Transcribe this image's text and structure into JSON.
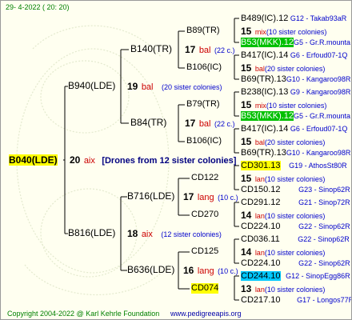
{
  "date": "29- 4-2022 ( 20: 20)",
  "root": {
    "id": "B040(LDE)",
    "num": "20",
    "breed": "aix",
    "drones": "[Drones from 12 sister colonies]"
  },
  "gen1": [
    {
      "id": "B940(LDE)",
      "num": "19",
      "breed": "bal",
      "colonies": "(20 sister colonies)"
    },
    {
      "id": "B816(LDE)",
      "num": "18",
      "breed": "aix",
      "colonies": "(12 sister colonies)"
    }
  ],
  "gen2": [
    {
      "id": "B140(TR)",
      "num": "17",
      "breed": "bal",
      "colonies": "(22 c.)"
    },
    {
      "id": "B84(TR)",
      "num": "17",
      "breed": "bal",
      "colonies": "(22 c.)"
    },
    {
      "id": "B716(LDE)",
      "num": "17",
      "breed": "lang",
      "colonies": "(10 c.)"
    },
    {
      "id": "B636(LDE)",
      "num": "16",
      "breed": "lang",
      "colonies": "(10 c.)"
    }
  ],
  "gen3": [
    {
      "id": "B89(TR)",
      "num": "15",
      "breed": "mix",
      "colonies": "(10 sister colonies)"
    },
    {
      "id": "B106(IC)",
      "num": "15",
      "breed": "bal",
      "colonies": "(20 sister colonies)"
    },
    {
      "id": "B79(TR)",
      "num": "15",
      "breed": "mix",
      "colonies": "(10 sister colonies)"
    },
    {
      "id": "B106(IC)",
      "num": "15",
      "breed": "bal",
      "colonies": "(20 sister colonies)"
    },
    {
      "id": "CD122",
      "num": "15",
      "breed": "lan",
      "colonies": "(10 sister colonies)"
    },
    {
      "id": "CD270",
      "num": "14",
      "breed": "lan",
      "colonies": "(10 sister colonies)"
    },
    {
      "id": "CD125",
      "num": "14",
      "breed": "lan",
      "colonies": "(10 sister colonies)"
    },
    {
      "id": "CD074",
      "num": "13",
      "breed": "lan",
      "colonies": "(10 sister colonies)"
    }
  ],
  "gen4": [
    {
      "id": "B489(IC).12",
      "info": "G12 - Takab93aR"
    },
    {
      "id": "B53(MKK).12",
      "info": "G5 - Gr.R.mounta"
    },
    {
      "id": "B417(IC).14",
      "info": "G6 - Erfoud07-1Q"
    },
    {
      "id": "B69(TR).13",
      "info": "G10 - Kangaroo98R"
    },
    {
      "id": "B238(IC).13",
      "info": "G9 - Kangaroo98R"
    },
    {
      "id": "B53(MKK).12",
      "info": "G5 - Gr.R.mounta"
    },
    {
      "id": "B417(IC).14",
      "info": "G6 - Erfoud07-1Q"
    },
    {
      "id": "B69(TR).13",
      "info": "G10 - Kangaroo98R"
    },
    {
      "id": "CD301.13",
      "info": "G19 - AthosSt80R"
    },
    {
      "id": "CD150.12",
      "info": "G23 - Sinop62R"
    },
    {
      "id": "CD291.12",
      "info": "G21 - Sinop72R"
    },
    {
      "id": "CD224.10",
      "info": "G22 - Sinop62R"
    },
    {
      "id": "CD036.11",
      "info": "G22 - Sinop62R"
    },
    {
      "id": "CD224.10",
      "info": "G22 - Sinop62R"
    },
    {
      "id": "CD244.10",
      "info": "G12 - SinopEgg86R"
    },
    {
      "id": "CD217.10",
      "info": "G17 - Longos77R"
    }
  ],
  "footer": {
    "copyright": "Copyright 2004-2022 @ Karl Kehrle Foundation",
    "url": "www.pedigreeapis.org"
  }
}
